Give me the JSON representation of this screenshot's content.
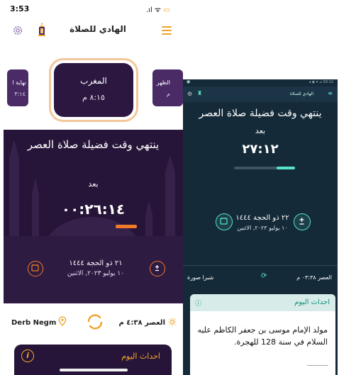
{
  "left_phone": {
    "status": {
      "time": "3:53",
      "icons": ".ıl ᯤ"
    },
    "header": {
      "title": "الهادي للصلاة"
    },
    "prayer_cards": {
      "prev": {
        "name": "نهاية ا",
        "time": "٣:١٤"
      },
      "current": {
        "name": "المغرب",
        "time": "٨:١٥ م"
      },
      "next": {
        "name": "الظهر",
        "time": "م"
      }
    },
    "main": {
      "heading": "ينتهي وقت فضيلة صلاة العصر",
      "after_label": "بعد",
      "countdown": "٠٠:٢٦:١٤",
      "hijri_date": "٢١ ذو الحجة ١٤٤٤",
      "gregorian_date": "١٠ يوليو ٢٠٢٣, الاثنين"
    },
    "location": {
      "name": "Derb Negm",
      "next_prayer": "العصر ٤:٣٨ م"
    },
    "events": {
      "title": "احداث اليوم",
      "info_symbol": "i"
    }
  },
  "right_tablet": {
    "status": {
      "left": "●",
      "right": "◂ ◉ ▾ ⊿ 03:12"
    },
    "header": {
      "title": "الهادي للصلاة"
    },
    "main": {
      "heading": "ينتهي وقت فضيلة صلاة العصر",
      "after_label": "بعد",
      "countdown": "٢٧:١٢",
      "hijri_date": "٢٢ ذو الحجة ١٤٤٤",
      "gregorian_date": "١٠ يوليو ٢٠٢٣, الاثنين"
    },
    "bottom_row": {
      "next_prayer": "العصر ٠٣:٣٨ م",
      "sunrise_label": "شبرا صورة"
    },
    "events": {
      "title": "احداث اليوم",
      "body": "مولد الإمام موسى بن جعفر الكاظم عليه السلام في سنة 128 للهجرة."
    }
  },
  "colors": {
    "purple_dark": "#261538",
    "accent_orange": "#f07a2a",
    "teal_accent": "#58e2c8",
    "tablet_bg": "#142a38"
  }
}
